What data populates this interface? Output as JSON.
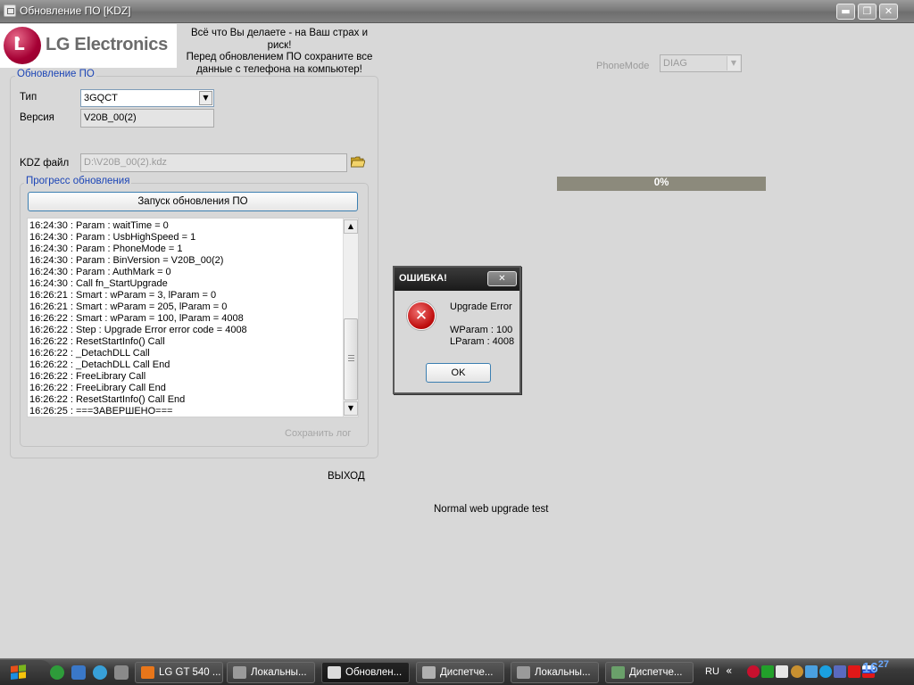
{
  "window": {
    "title": "Обновление ПО [KDZ]",
    "buttons": {
      "minimize": "▬",
      "maximize": "❐",
      "close": "✕"
    }
  },
  "branding": {
    "logo_text": "LG Electronics",
    "logo_letter": "L"
  },
  "warning_lines": [
    "Всё что Вы делаете - на Ваш страх и риск!",
    "Перед обновлением ПО сохраните все",
    "данные с телефона на компьютер!"
  ],
  "phonemode": {
    "label": "PhoneMode",
    "value": "DIAG"
  },
  "update_group": {
    "legend": "Обновление ПО",
    "type_label": "Тип",
    "type_value": "3GQCT",
    "version_label": "Версия",
    "version_value": "V20B_00(2)",
    "kdz_label": "KDZ файл",
    "kdz_value": "D:\\V20B_00(2).kdz"
  },
  "progress_group": {
    "legend": "Прогресс обновления",
    "start_button": "Запуск обновления ПО",
    "save_log": "Сохранить лог"
  },
  "log": [
    "16:24:30 : Param : waitTime = 0",
    "16:24:30 : Param : UsbHighSpeed = 1",
    "16:24:30 : Param : PhoneMode = 1",
    "16:24:30 : Param : BinVersion = V20B_00(2)",
    "16:24:30 : Param : AuthMark = 0",
    "16:24:30 : Call fn_StartUpgrade",
    "16:26:21 : Smart : wParam = 3, lParam = 0",
    "16:26:21 : Smart : wParam = 205, lParam = 0",
    "16:26:22 : Smart : wParam = 100, lParam = 4008",
    "16:26:22 : Step : Upgrade Error error code = 4008",
    "16:26:22 : ResetStartInfo() Call",
    "16:26:22 : _DetachDLL Call",
    "16:26:22 : _DetachDLL Call End",
    "16:26:22 : FreeLibrary Call",
    "16:26:22 : FreeLibrary Call End",
    "16:26:22 : ResetStartInfo() Call End",
    "16:26:25 : ===ЗАВЕРШЕНО==="
  ],
  "exit_label": "ВЫХОД",
  "status_text": "Normal web upgrade test",
  "progress": {
    "value": 0,
    "text": "0%"
  },
  "dialog": {
    "title": "ОШИБКА!",
    "close": "✕",
    "icon": "error-icon",
    "icon_glyph": "✕",
    "message": "Upgrade Error",
    "wparam": "WParam : 100",
    "lparam": "LParam : 4008",
    "ok": "OK"
  },
  "taskbar": {
    "tasks": [
      {
        "label": "LG GT 540 ...",
        "icon": "firefox-icon",
        "color": "#e8761a"
      },
      {
        "label": "Локальны...",
        "icon": "drive-icon",
        "color": "#9a9a9a"
      },
      {
        "label": "Обновлен...",
        "icon": "app-window-icon",
        "color": "#dcdcdc"
      },
      {
        "label": "Диспетче...",
        "icon": "device-manager-icon",
        "color": "#b0b0b0"
      },
      {
        "label": "Локальны...",
        "icon": "drive-icon",
        "color": "#9a9a9a"
      },
      {
        "label": "Диспетче...",
        "icon": "task-manager-icon",
        "color": "#6aa06a"
      }
    ],
    "language": "RU",
    "chevron": "«",
    "clock_hour": "16",
    "clock_min": "27"
  },
  "colors": {
    "legend_blue": "#1c45b6",
    "logo_red": "#a50034",
    "progress_bar": "#8c8a7c",
    "dialog_title": "#1a1a1a",
    "clock": "#6aa8ff"
  }
}
